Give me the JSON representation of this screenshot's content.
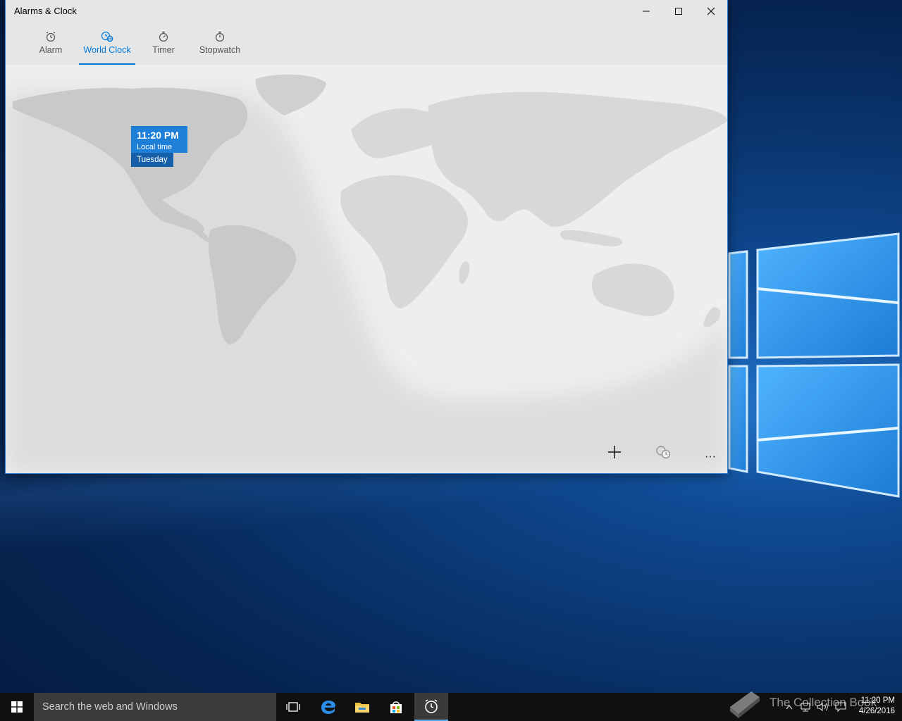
{
  "window": {
    "title": "Alarms & Clock",
    "minimize": "—",
    "maximize": "☐",
    "close": "✕"
  },
  "tabs": [
    {
      "label": "Alarm",
      "icon": "alarm-clock-icon",
      "active": false
    },
    {
      "label": "World Clock",
      "icon": "globe-clock-icon",
      "active": true
    },
    {
      "label": "Timer",
      "icon": "timer-icon",
      "active": false
    },
    {
      "label": "Stopwatch",
      "icon": "stopwatch-icon",
      "active": false
    }
  ],
  "local_clock": {
    "time": "11:20 PM",
    "label": "Local time",
    "day": "Tuesday"
  },
  "commands": {
    "add": "add-icon",
    "compare": "compare-clock-icon",
    "more": "···"
  },
  "taskbar": {
    "search_placeholder": "Search the web and Windows",
    "clock_time": "11:20 PM",
    "clock_date": "4/26/2016",
    "watermark": "The Collection Book"
  },
  "colors": {
    "accent": "#0078d7",
    "time_card": "#1e7fd8",
    "day_card": "#1560a8",
    "land": "#d9d9d9",
    "night_land": "#c8c8c8"
  }
}
